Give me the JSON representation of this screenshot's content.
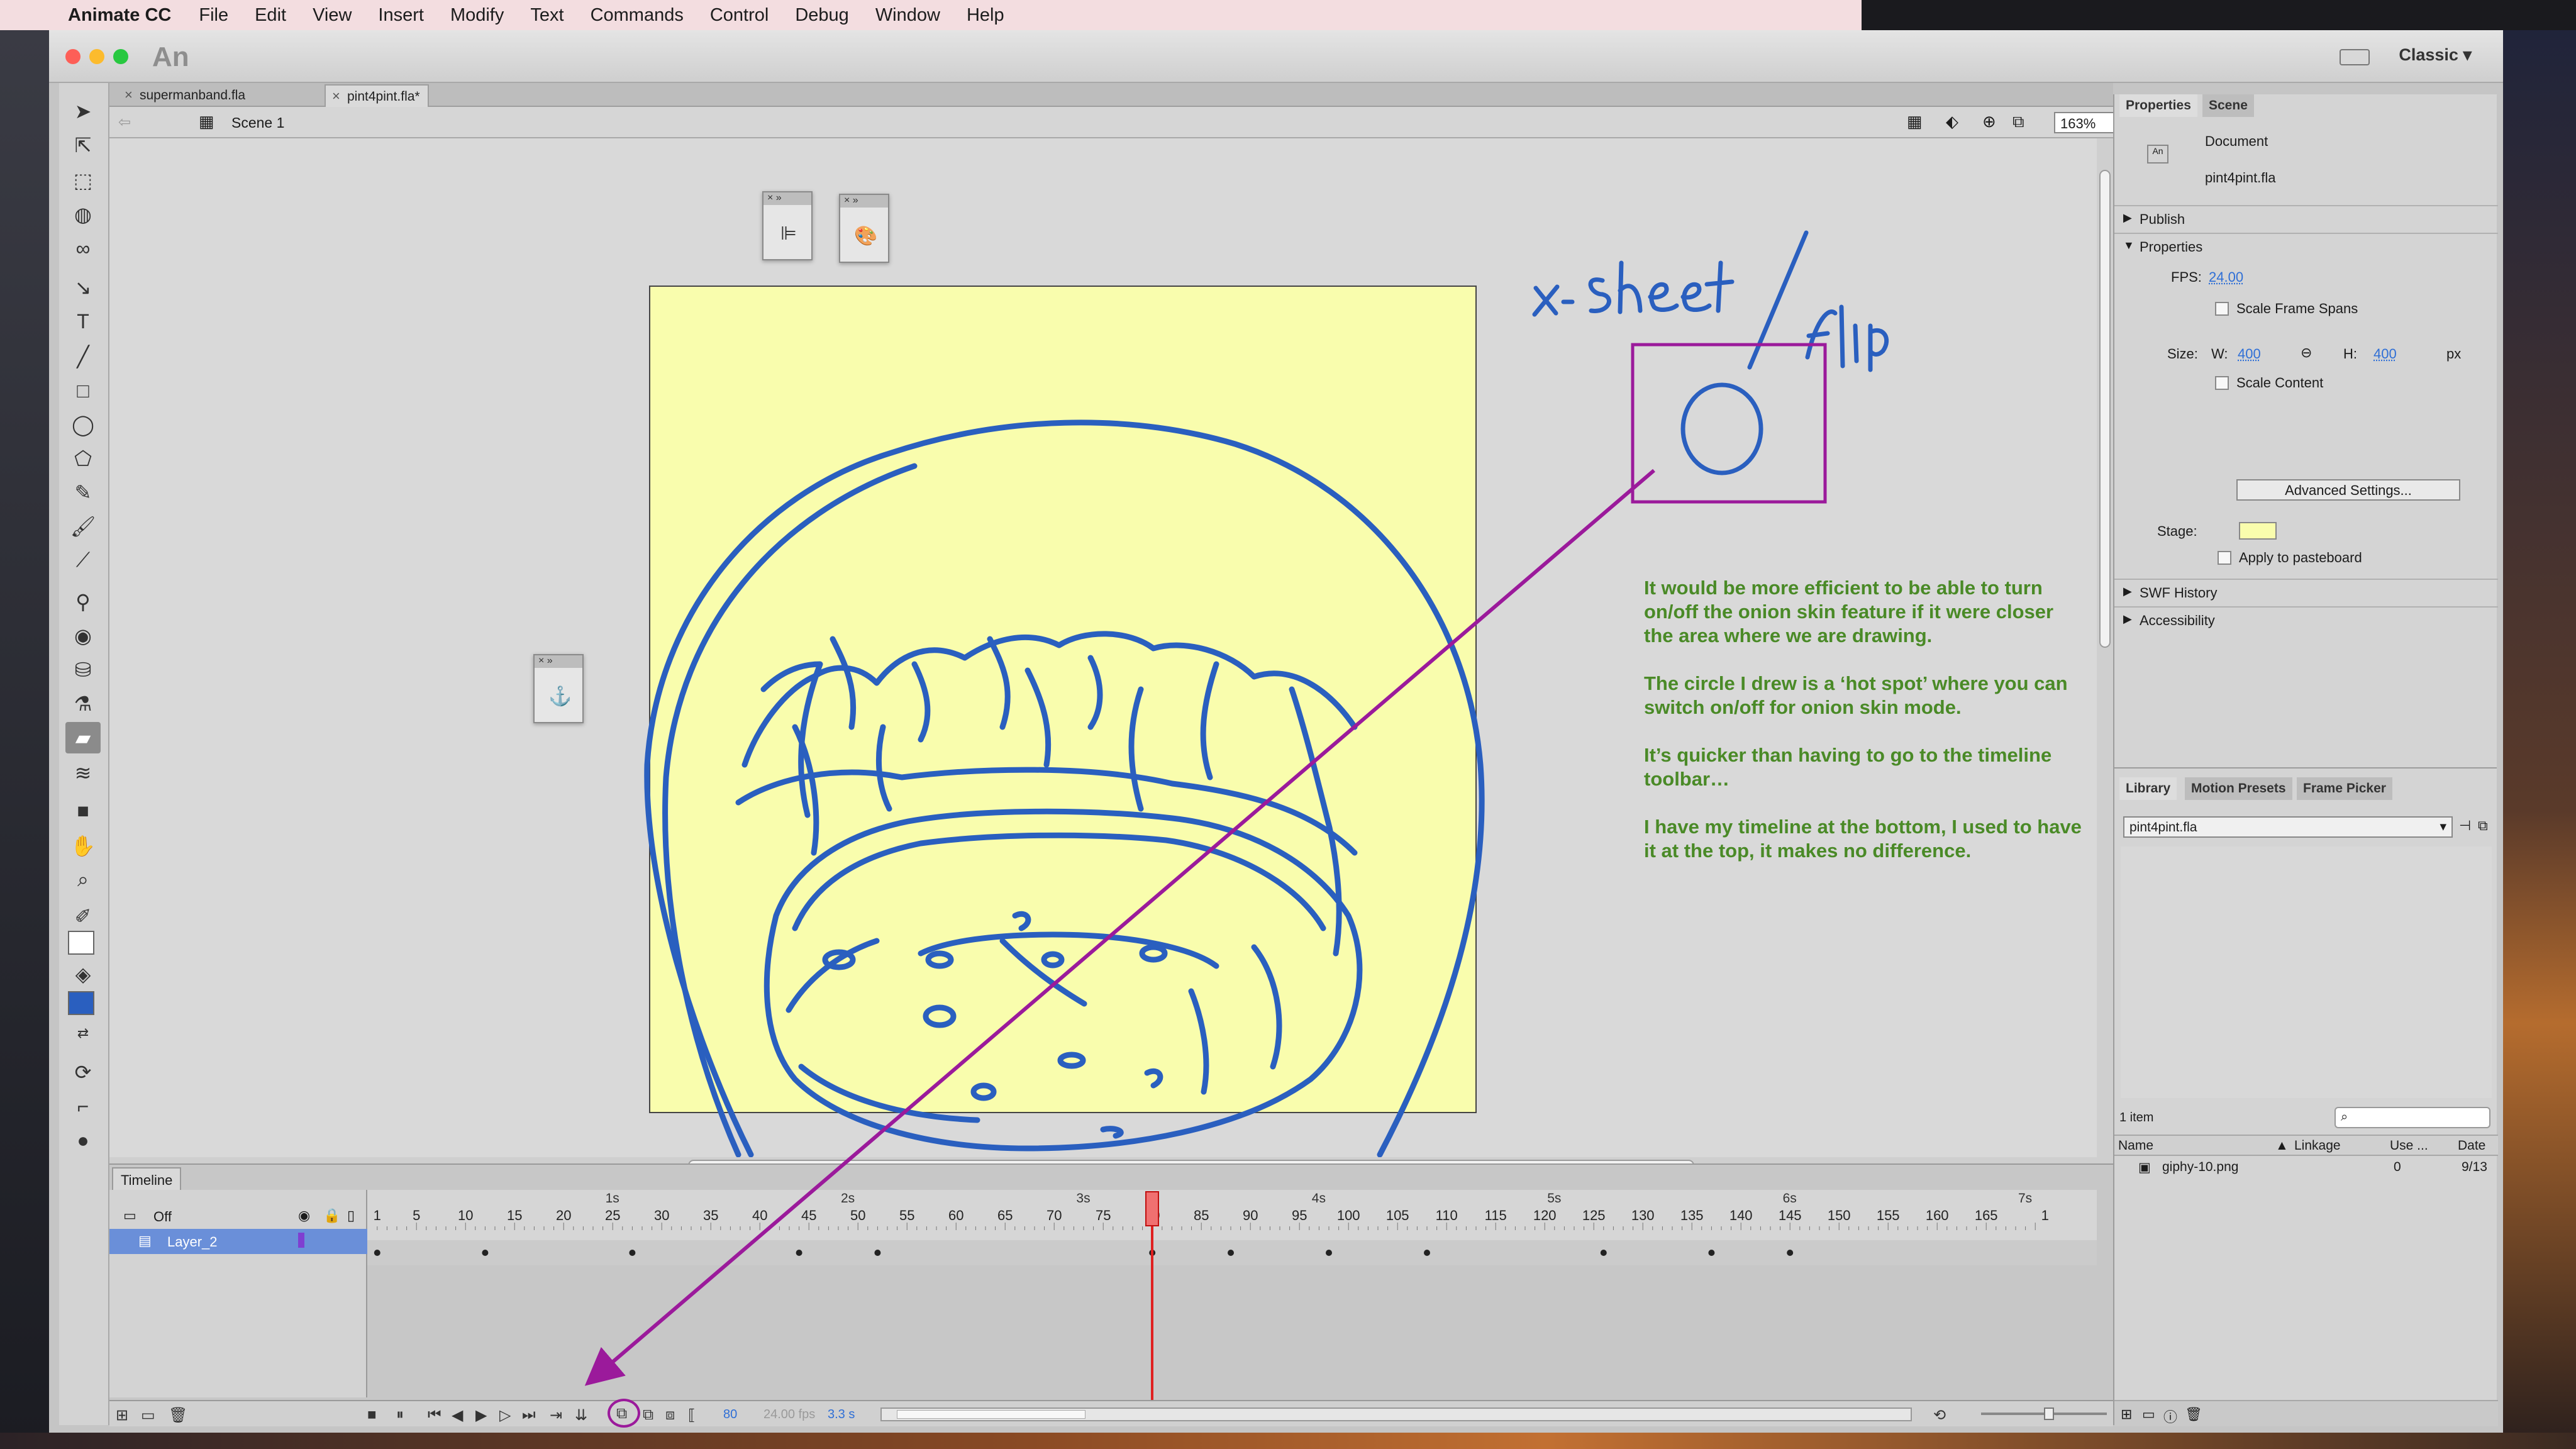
{
  "menubar": {
    "app": "Animate CC",
    "items": [
      "File",
      "Edit",
      "View",
      "Insert",
      "Modify",
      "Text",
      "Commands",
      "Control",
      "Debug",
      "Window",
      "Help"
    ]
  },
  "window": {
    "logo": "An",
    "workspace": "Classic ▾",
    "traffic_colors": [
      "#fd5f57",
      "#fcbb2d",
      "#28c840"
    ]
  },
  "doc_tabs": [
    {
      "label": "supermanband.fla",
      "active": false
    },
    {
      "label": "pint4pint.fla*",
      "active": true
    }
  ],
  "edit_bar": {
    "scene": "Scene 1",
    "zoom": "163%"
  },
  "stage": {
    "color": "#f9fdad",
    "stroke_color": "#2a5fbf"
  },
  "annotation": {
    "handwriting": "x- sheet / flip",
    "color": "#9b1a9b",
    "note": [
      "It would be more efficient to be able to turn on/off the onion skin feature if it were closer the area where we are drawing.",
      "The circle I drew is a ‘hot spot’ where you can switch on/off for onion skin mode.",
      "It’s quicker than having to go to the timeline toolbar…",
      "I have my timeline at the bottom, I used to have it at the top, it makes no difference."
    ],
    "note_color": "#4a8a27"
  },
  "timeline": {
    "tab": "Timeline",
    "outline_row": "Off",
    "layer": "Layer_2",
    "ruler_numbers": [
      "1",
      "5",
      "10",
      "15",
      "20",
      "25",
      "30",
      "35",
      "40",
      "45",
      "50",
      "55",
      "60",
      "65",
      "70",
      "75",
      "80",
      "85",
      "90",
      "95",
      "100",
      "105",
      "110",
      "115",
      "120",
      "125",
      "130",
      "135",
      "140",
      "145",
      "150",
      "155",
      "160",
      "165",
      "1"
    ],
    "seconds": [
      "1s",
      "2s",
      "3s",
      "4s",
      "5s",
      "6s",
      "7s"
    ],
    "keyframes": [
      1,
      12,
      27,
      44,
      52,
      80,
      88,
      98,
      108,
      126,
      137,
      145
    ],
    "current_frame": "80",
    "fps": "24.00 fps",
    "time": "3.3 s"
  },
  "properties": {
    "tabs": [
      "Properties",
      "Scene"
    ],
    "type": "Document",
    "filename": "pint4pint.fla",
    "sections": [
      "Publish",
      "Properties",
      "SWF History",
      "Accessibility"
    ],
    "fps_label": "FPS:",
    "fps_value": "24.00",
    "scale_frame_spans": "Scale Frame Spans",
    "size_label": "Size:",
    "w_label": "W:",
    "w_value": "400",
    "h_label": "H:",
    "h_value": "400",
    "unit": "px",
    "scale_content": "Scale Content",
    "advanced_button": "Advanced Settings...",
    "stage_label": "Stage:",
    "apply_pasteboard": "Apply to pasteboard"
  },
  "library": {
    "tabs": [
      "Library",
      "Motion Presets",
      "Frame Picker"
    ],
    "selected": "pint4pint.fla",
    "count": "1 item",
    "columns": [
      "Name",
      "Linkage",
      "Use ...",
      "Date"
    ],
    "items": [
      {
        "name": "giphy-10.png",
        "linkage": "",
        "use": "0",
        "date": "9/13"
      }
    ]
  }
}
